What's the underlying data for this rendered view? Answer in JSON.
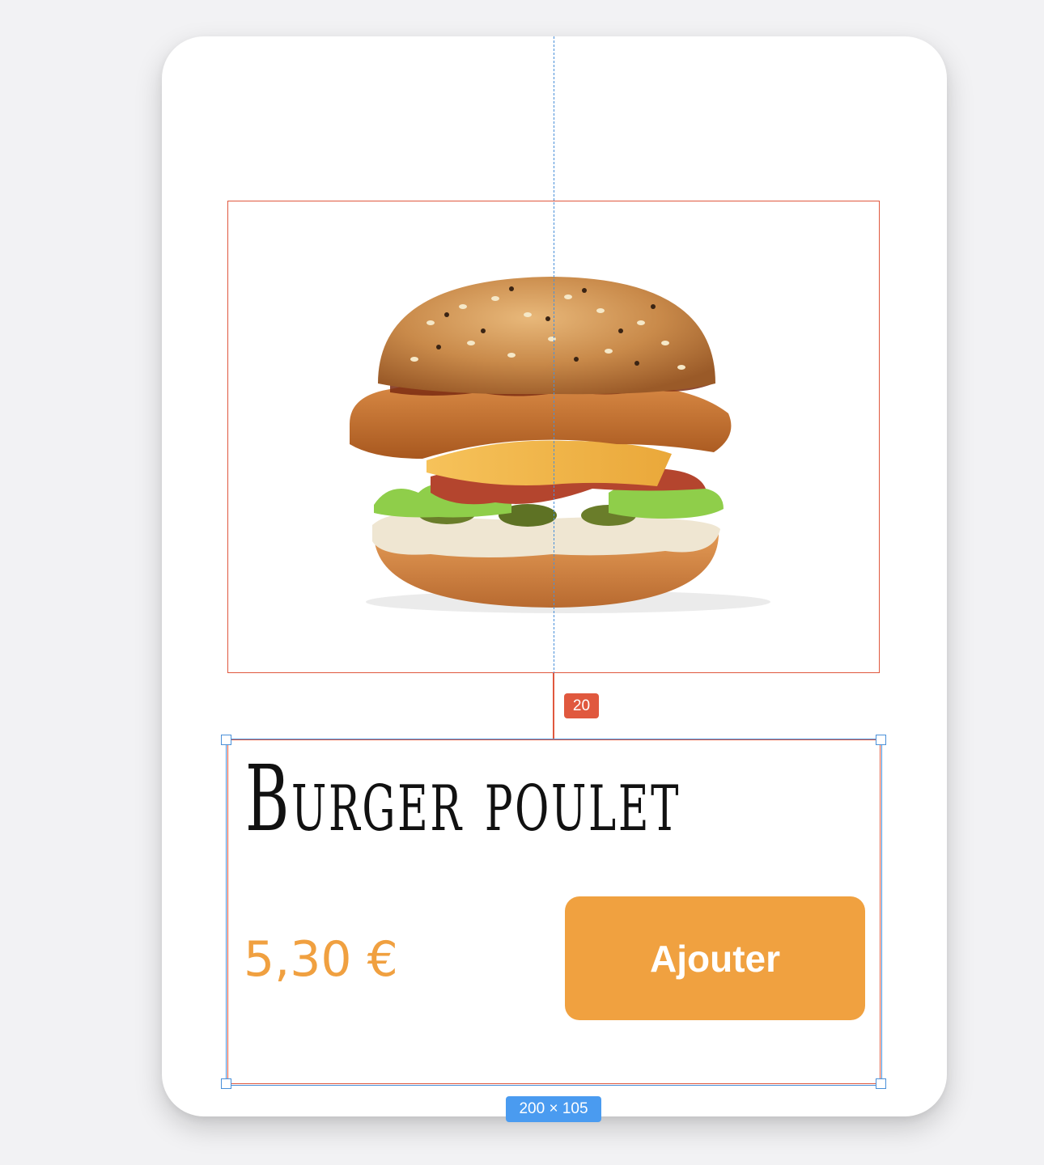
{
  "product": {
    "title": "Burger poulet",
    "price": "5,30 €",
    "add_button_label": "Ajouter",
    "image_name": "chicken-burger-image"
  },
  "inspector": {
    "gap_label": "20",
    "size_label": "200 × 105"
  },
  "colors": {
    "page_background": "#f2f2f4",
    "card_background": "#ffffff",
    "accent_orange": "#f0a140",
    "guide_red": "#e0583e",
    "selection_blue": "#4a90d9"
  }
}
